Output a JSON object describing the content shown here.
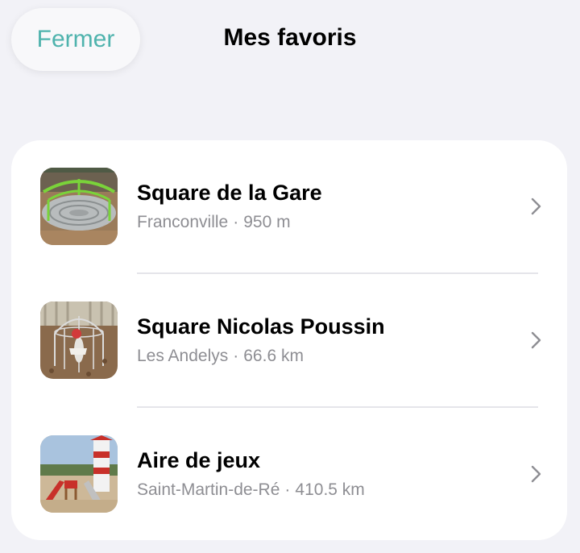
{
  "header": {
    "close_label": "Fermer",
    "title": "Mes favoris"
  },
  "favorites": [
    {
      "title": "Square de la Gare",
      "city": "Franconville",
      "separator": "·",
      "distance": "950 m",
      "thumbnail": "merry-go-round-photo"
    },
    {
      "title": "Square Nicolas Poussin",
      "city": "Les Andelys",
      "separator": "·",
      "distance": "66.6 km",
      "thumbnail": "spring-rider-photo"
    },
    {
      "title": "Aire de jeux",
      "city": "Saint-Martin-de-Ré",
      "separator": "·",
      "distance": "410.5 km",
      "thumbnail": "lighthouse-playground-photo"
    }
  ],
  "colors": {
    "accent": "#4fb3ad",
    "background": "#f2f2f7",
    "secondary_text": "#8e8e93"
  }
}
